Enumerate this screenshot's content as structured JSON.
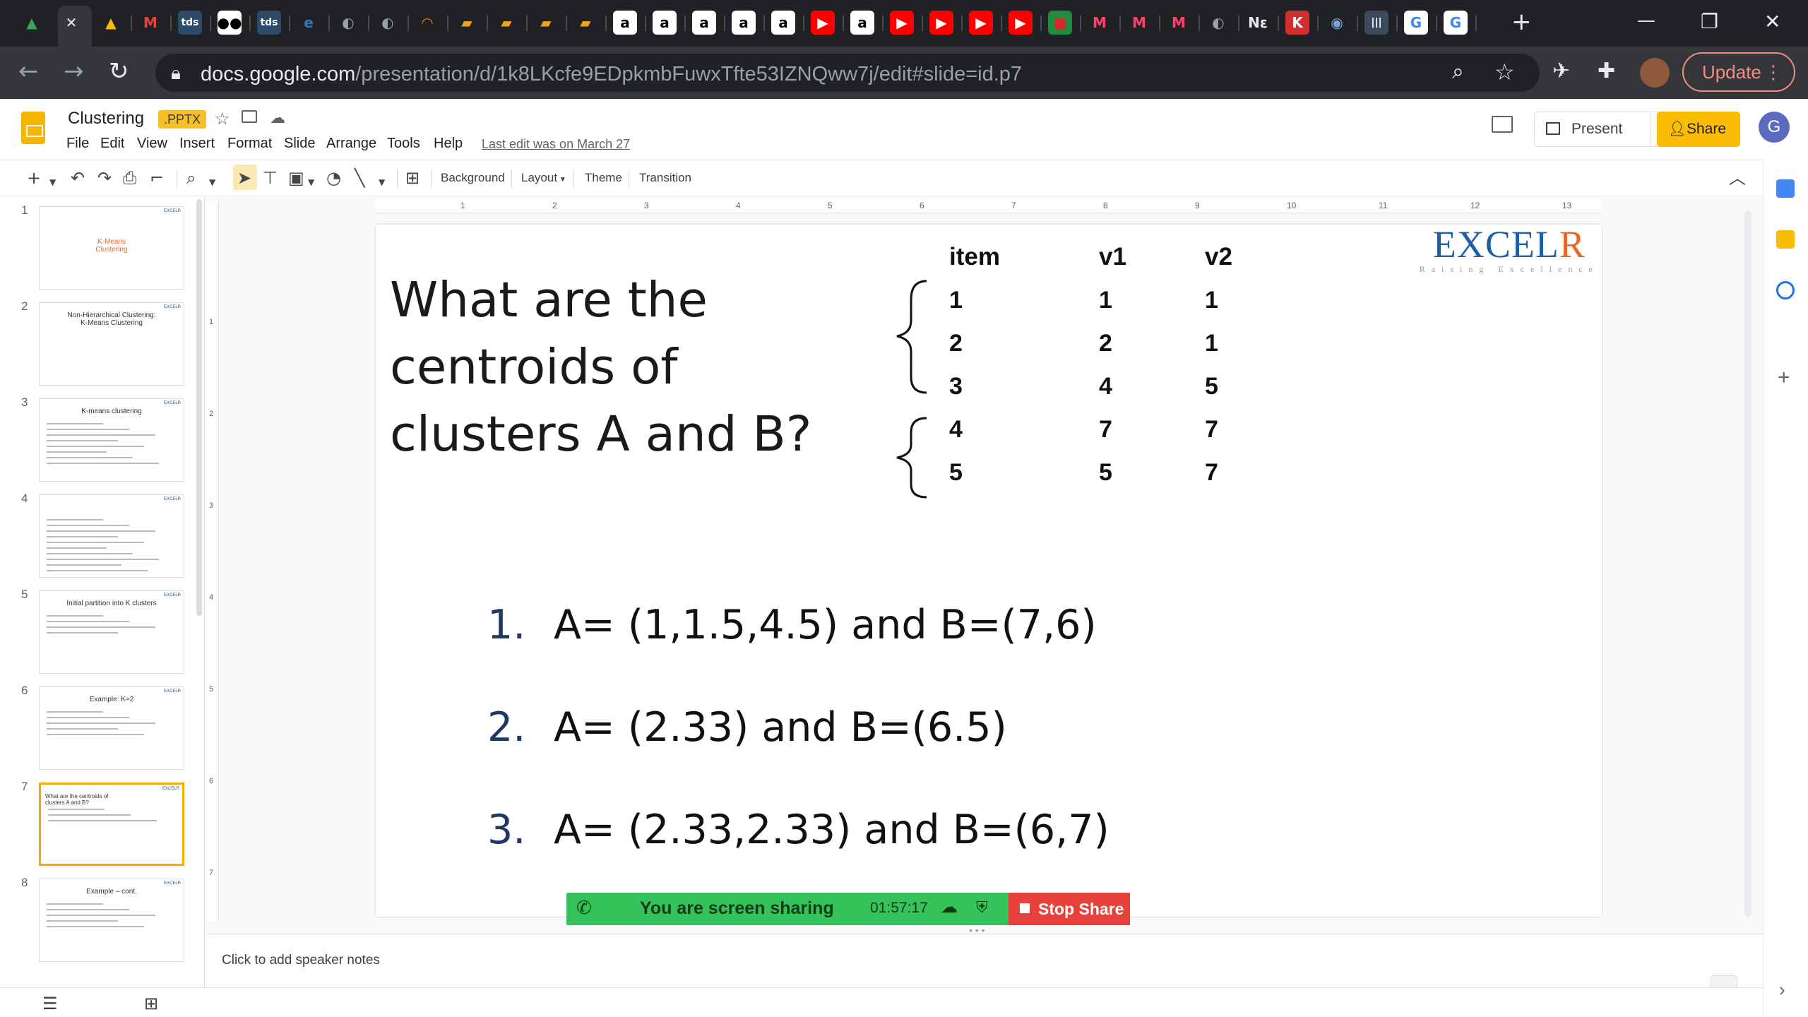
{
  "browser": {
    "tab_icons": [
      {
        "name": "google-drive-icon",
        "glyph": "▲",
        "color": "#34a853",
        "bg": "transparent"
      },
      {
        "name": "close-tab-icon",
        "glyph": "✕",
        "color": "#e8eaed",
        "bg": "transparent"
      },
      {
        "name": "google-drive-icon",
        "glyph": "▲",
        "color": "#fbbc04",
        "bg": "transparent"
      },
      {
        "name": "gmail-icon",
        "glyph": "M",
        "color": "#ea4335",
        "bg": "transparent"
      },
      {
        "name": "tds-icon",
        "glyph": "tds",
        "color": "#ffffff",
        "bg": "#2d4a6b"
      },
      {
        "name": "medium-icon",
        "glyph": "●●",
        "color": "#000000",
        "bg": "#ffffff"
      },
      {
        "name": "tds-icon",
        "glyph": "tds",
        "color": "#ffffff",
        "bg": "#2d4a6b"
      },
      {
        "name": "edge-icon",
        "glyph": "e",
        "color": "#3277bc",
        "bg": "transparent"
      },
      {
        "name": "globe-icon",
        "glyph": "◐",
        "color": "#9aa0a6",
        "bg": "transparent"
      },
      {
        "name": "globe-icon",
        "glyph": "◐",
        "color": "#9aa0a6",
        "bg": "transparent"
      },
      {
        "name": "loading-icon",
        "glyph": "◠",
        "color": "#f57c00",
        "bg": "transparent"
      },
      {
        "name": "book-icon",
        "glyph": "▰",
        "color": "#f7a21b",
        "bg": "transparent"
      },
      {
        "name": "book-icon",
        "glyph": "▰",
        "color": "#f7a21b",
        "bg": "transparent"
      },
      {
        "name": "book-icon",
        "glyph": "▰",
        "color": "#f7a21b",
        "bg": "transparent"
      },
      {
        "name": "book-icon",
        "glyph": "▰",
        "color": "#f7a21b",
        "bg": "transparent"
      },
      {
        "name": "amazon-icon",
        "glyph": "a",
        "color": "#000000",
        "bg": "#ffffff"
      },
      {
        "name": "amazon-icon",
        "glyph": "a",
        "color": "#000000",
        "bg": "#ffffff"
      },
      {
        "name": "amazon-icon",
        "glyph": "a",
        "color": "#000000",
        "bg": "#ffffff"
      },
      {
        "name": "amazon-icon",
        "glyph": "a",
        "color": "#000000",
        "bg": "#ffffff"
      },
      {
        "name": "amazon-icon",
        "glyph": "a",
        "color": "#000000",
        "bg": "#ffffff"
      },
      {
        "name": "youtube-icon",
        "glyph": "▶",
        "color": "#ffffff",
        "bg": "#ff0000"
      },
      {
        "name": "amazon-icon",
        "glyph": "a",
        "color": "#000000",
        "bg": "#ffffff"
      },
      {
        "name": "youtube-icon",
        "glyph": "▶",
        "color": "#ffffff",
        "bg": "#ff0000"
      },
      {
        "name": "youtube-icon",
        "glyph": "▶",
        "color": "#ffffff",
        "bg": "#ff0000"
      },
      {
        "name": "youtube-icon",
        "glyph": "▶",
        "color": "#ffffff",
        "bg": "#ff0000"
      },
      {
        "name": "youtube-icon",
        "glyph": "▶",
        "color": "#ffffff",
        "bg": "#ff0000"
      },
      {
        "name": "flag-icon",
        "glyph": "■",
        "color": "#d62828",
        "bg": "#1e8e3e"
      },
      {
        "name": "myntra-icon",
        "glyph": "M",
        "color": "#ff3f6c",
        "bg": "transparent"
      },
      {
        "name": "myntra-icon",
        "glyph": "M",
        "color": "#ff3f6c",
        "bg": "transparent"
      },
      {
        "name": "myntra-icon",
        "glyph": "M",
        "color": "#ff3f6c",
        "bg": "transparent"
      },
      {
        "name": "globe-icon",
        "glyph": "◐",
        "color": "#9aa0a6",
        "bg": "transparent"
      },
      {
        "name": "tab-text-icon",
        "glyph": "Nε",
        "color": "#e8eaed",
        "bg": "transparent"
      },
      {
        "name": "k-icon",
        "glyph": "K",
        "color": "#ffffff",
        "bg": "#d32f2f"
      },
      {
        "name": "globe-icon",
        "glyph": "◉",
        "color": "#7aa6d6",
        "bg": "transparent"
      },
      {
        "name": "bars-icon",
        "glyph": "|||",
        "color": "#ffffff",
        "bg": "#3c4a5e"
      },
      {
        "name": "google-icon",
        "glyph": "G",
        "color": "#4285f4",
        "bg": "#ffffff"
      },
      {
        "name": "google-icon",
        "glyph": "G",
        "color": "#4285f4",
        "bg": "#ffffff"
      }
    ],
    "new_tab": "+",
    "window_controls": {
      "minimize": "—",
      "restore": "❐",
      "close": "✕"
    },
    "url_host": "docs.google.com",
    "url_path": "/presentation/d/1k8LKcfe9EDpkmbFuwxTfte53IZNQww7j/edit#slide=id.p7",
    "update_label": "Update"
  },
  "doc": {
    "title": "Clustering",
    "badge": ".PPTX",
    "menu": [
      "File",
      "Edit",
      "View",
      "Insert",
      "Format",
      "Slide",
      "Arrange",
      "Tools",
      "Help"
    ],
    "last_edit": "Last edit was on March 27",
    "present_label": "Present",
    "share_label": "Share",
    "avatar_letter": "G"
  },
  "toolbar": {
    "background": "Background",
    "layout": "Layout",
    "theme": "Theme",
    "transition": "Transition"
  },
  "filmstrip": {
    "slides": [
      {
        "num": "1",
        "title": "K-Means\nClustering",
        "color": "#e8672a"
      },
      {
        "num": "2",
        "title": "Non-Hierarchical Clustering:\nK-Means Clustering",
        "color": "#333"
      },
      {
        "num": "3",
        "title": "K-means clustering",
        "color": "#333"
      },
      {
        "num": "4",
        "title": "",
        "color": "#333"
      },
      {
        "num": "5",
        "title": "Initial partition into K clusters",
        "color": "#333"
      },
      {
        "num": "6",
        "title": "Example: K=2",
        "color": "#333"
      },
      {
        "num": "7",
        "title": "What are the centroids of clusters A and B?",
        "color": "#333"
      },
      {
        "num": "8",
        "title": "Example – cont.",
        "color": "#333"
      }
    ],
    "selected_index": 6
  },
  "ruler": {
    "h_marks": [
      "1",
      "2",
      "3",
      "4",
      "5",
      "6",
      "7",
      "8",
      "9",
      "10",
      "11",
      "12",
      "13"
    ],
    "v_marks": [
      "1",
      "2",
      "3",
      "4",
      "5",
      "6",
      "7"
    ]
  },
  "slide": {
    "question": "What are the centroids of clusters A and B?",
    "table": {
      "headers": [
        "item",
        "v1",
        "v2"
      ],
      "rows": [
        [
          "1",
          "1",
          "1"
        ],
        [
          "2",
          "2",
          "1"
        ],
        [
          "3",
          "4",
          "5"
        ],
        [
          "4",
          "7",
          "7"
        ],
        [
          "5",
          "5",
          "7"
        ]
      ]
    },
    "answers": [
      {
        "num": "1.",
        "text": "A= (1,1.5,4.5) and B=(7,6)"
      },
      {
        "num": "2.",
        "text": "A= (2.33) and B=(6.5)"
      },
      {
        "num": "3.",
        "text": "A= (2.33,2.33) and B=(6,7)"
      }
    ],
    "logo_main_1": "EXCEL",
    "logo_main_2": "R",
    "logo_tagline": "Raising Excellence"
  },
  "screen_share": {
    "label": "You are screen sharing",
    "timer": "01:57:17",
    "stop_label": "Stop Share"
  },
  "notes": {
    "placeholder": "Click to add speaker notes"
  }
}
